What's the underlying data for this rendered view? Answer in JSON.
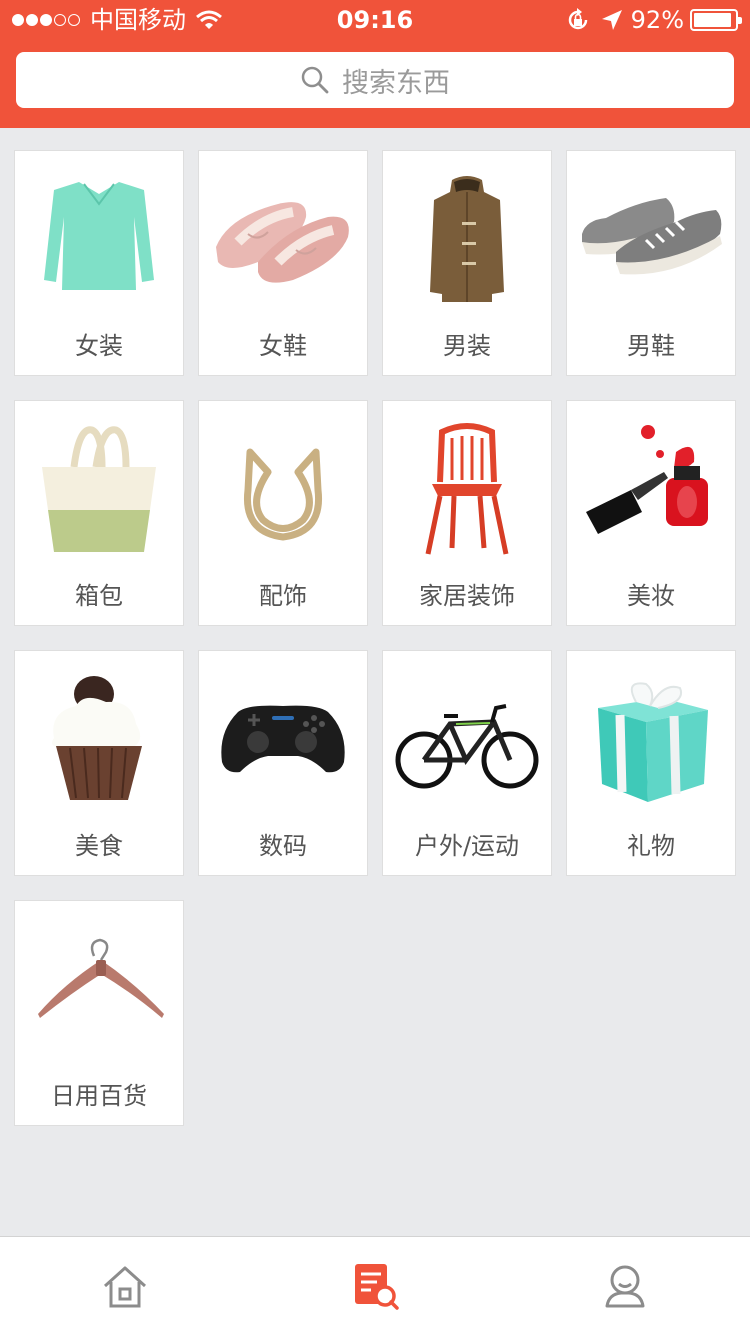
{
  "status_bar": {
    "carrier": "中国移动",
    "time": "09:16",
    "battery": "92%",
    "battery_level": 0.92,
    "signal_bars_filled": 3,
    "signal_bars_total": 5
  },
  "search": {
    "placeholder": "搜索东西"
  },
  "categories": [
    {
      "label": "女装",
      "icon": "sweater-icon"
    },
    {
      "label": "女鞋",
      "icon": "flats-icon"
    },
    {
      "label": "男装",
      "icon": "coat-icon"
    },
    {
      "label": "男鞋",
      "icon": "sneakers-icon"
    },
    {
      "label": "箱包",
      "icon": "tote-bag-icon"
    },
    {
      "label": "配饰",
      "icon": "ring-icon"
    },
    {
      "label": "家居装饰",
      "icon": "chair-icon"
    },
    {
      "label": "美妆",
      "icon": "nail-polish-icon"
    },
    {
      "label": "美食",
      "icon": "cupcake-icon"
    },
    {
      "label": "数码",
      "icon": "gamepad-icon"
    },
    {
      "label": "户外/运动",
      "icon": "bicycle-icon"
    },
    {
      "label": "礼物",
      "icon": "gift-box-icon"
    },
    {
      "label": "日用百货",
      "icon": "hanger-icon"
    }
  ],
  "tabbar": {
    "tabs": [
      {
        "name": "home",
        "icon": "home-icon",
        "active": false
      },
      {
        "name": "search",
        "icon": "list-search-icon",
        "active": true
      },
      {
        "name": "profile",
        "icon": "user-icon",
        "active": false
      }
    ]
  },
  "colors": {
    "brand": "#f0533a",
    "background": "#e9eaec",
    "tab_inactive": "#8c8c8c",
    "tab_active": "#f0533a"
  }
}
